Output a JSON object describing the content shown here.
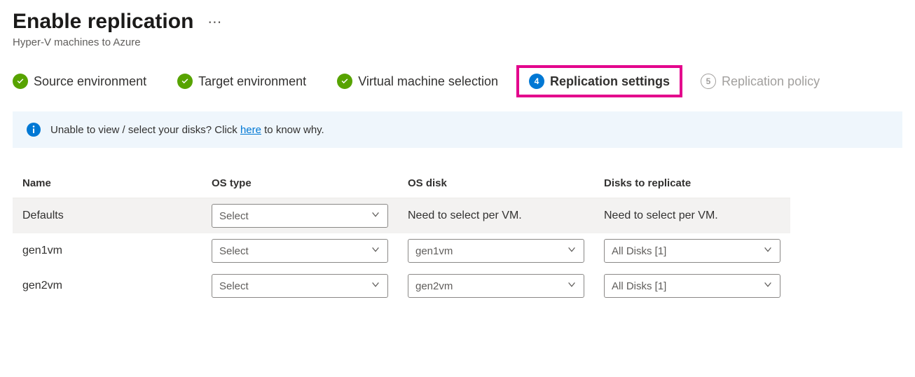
{
  "header": {
    "title": "Enable replication",
    "subtitle": "Hyper-V machines to Azure"
  },
  "steps": [
    {
      "label": "Source environment",
      "state": "done"
    },
    {
      "label": "Target environment",
      "state": "done"
    },
    {
      "label": "Virtual machine selection",
      "state": "done"
    },
    {
      "label": "Replication settings",
      "state": "active",
      "num": "4"
    },
    {
      "label": "Replication policy",
      "state": "inactive",
      "num": "5"
    }
  ],
  "banner": {
    "text_pre": "Unable to view / select your disks? Click ",
    "link": "here",
    "text_post": " to know why."
  },
  "table": {
    "headers": {
      "name": "Name",
      "os_type": "OS type",
      "os_disk": "OS disk",
      "disks": "Disks to replicate"
    },
    "rows": [
      {
        "name": "Defaults",
        "os_type": "Select",
        "os_disk_text": "Need to select per VM.",
        "disks_text": "Need to select per VM.",
        "default_row": true
      },
      {
        "name": "gen1vm",
        "os_type": "Select",
        "os_disk": "gen1vm",
        "disks": "All Disks [1]"
      },
      {
        "name": "gen2vm",
        "os_type": "Select",
        "os_disk": "gen2vm",
        "disks": "All Disks [1]"
      }
    ]
  }
}
